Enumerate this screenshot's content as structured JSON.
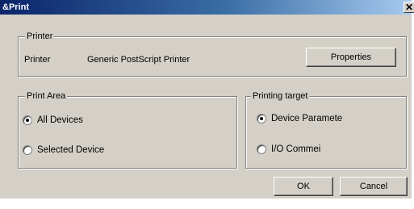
{
  "window": {
    "title": "&Print",
    "close_glyph": "✕"
  },
  "printer_group": {
    "legend": "Printer",
    "label": "Printer",
    "printer_name": "Generic PostScript Printer",
    "properties_button": "Properties"
  },
  "print_area": {
    "legend": "Print Area",
    "options": [
      {
        "label": "All Devices",
        "selected": true
      },
      {
        "label": "Selected Device",
        "selected": false
      }
    ]
  },
  "printing_target": {
    "legend": "Printing target",
    "options": [
      {
        "label": "Device Paramete",
        "selected": true
      },
      {
        "label": "I/O Commei",
        "selected": false
      }
    ]
  },
  "buttons": {
    "ok": "OK",
    "cancel": "Cancel"
  }
}
